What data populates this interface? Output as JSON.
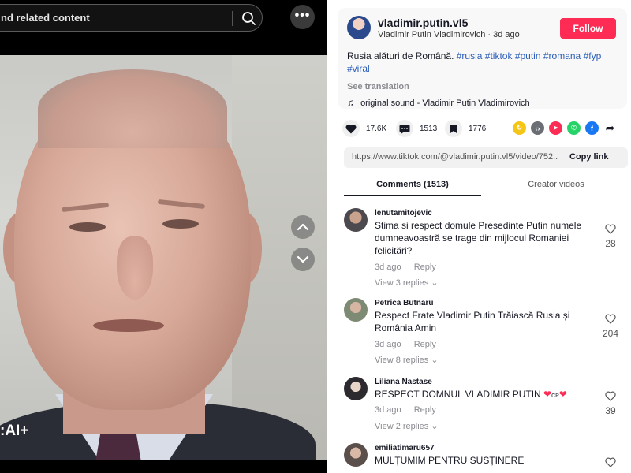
{
  "search": {
    "text": "nd related content",
    "icon": "search-icon"
  },
  "video": {
    "watermark": ":AI+",
    "more_icon": "more-icon",
    "up_icon": "chevron-up-icon",
    "down_icon": "chevron-down-icon"
  },
  "author": {
    "username": "vladimir.putin.vl5",
    "display_name": "Vladimir Putin Vladimirovich",
    "time": "3d ago",
    "follow_label": "Follow"
  },
  "caption": {
    "text": "Rusia alături de Română.",
    "hashtags": [
      "#rusia",
      "#tiktok",
      "#putin",
      "#romana",
      "#fyp",
      "#viral"
    ],
    "see_translation": "See translation",
    "music": "original sound - Vladimir Putin Vladimirovich"
  },
  "stats": {
    "likes": "17.6K",
    "comments": "1513",
    "saves": "1776"
  },
  "link": {
    "url": "https://www.tiktok.com/@vladimir.putin.vl5/video/752...",
    "copy_label": "Copy link"
  },
  "tabs": {
    "comments": "Comments (1513)",
    "creator": "Creator videos"
  },
  "comments": [
    {
      "user": "lenutamitojevic",
      "text": "Stima si respect domule Presedinte Putin numele dumneavoastră se trage din mijlocul Romaniei felicitări?",
      "time": "3d ago",
      "reply": "Reply",
      "replies": "View 3 replies",
      "likes": "28"
    },
    {
      "user": "Petrica Butnaru",
      "text": "Respect Frate Vladimir Putin Trăiască Rusia și România Amin",
      "time": "3d ago",
      "reply": "Reply",
      "replies": "View 8 replies",
      "likes": "204"
    },
    {
      "user": "Liliana Nastase",
      "text": "RESPECT DOMNUL VLADIMIR PUTIN",
      "emoji_text": "CP",
      "time": "3d ago",
      "reply": "Reply",
      "replies": "View 2 replies",
      "likes": "39"
    },
    {
      "user": "emiliatimaru657",
      "text": "MULȚUMIM PENTRU SUSȚINERE",
      "time": "",
      "reply": "",
      "replies": "",
      "likes": ""
    }
  ],
  "colors": {
    "follow": "#fe2c55",
    "hashtag": "#2b5db9",
    "muted": "#8a8b91"
  }
}
